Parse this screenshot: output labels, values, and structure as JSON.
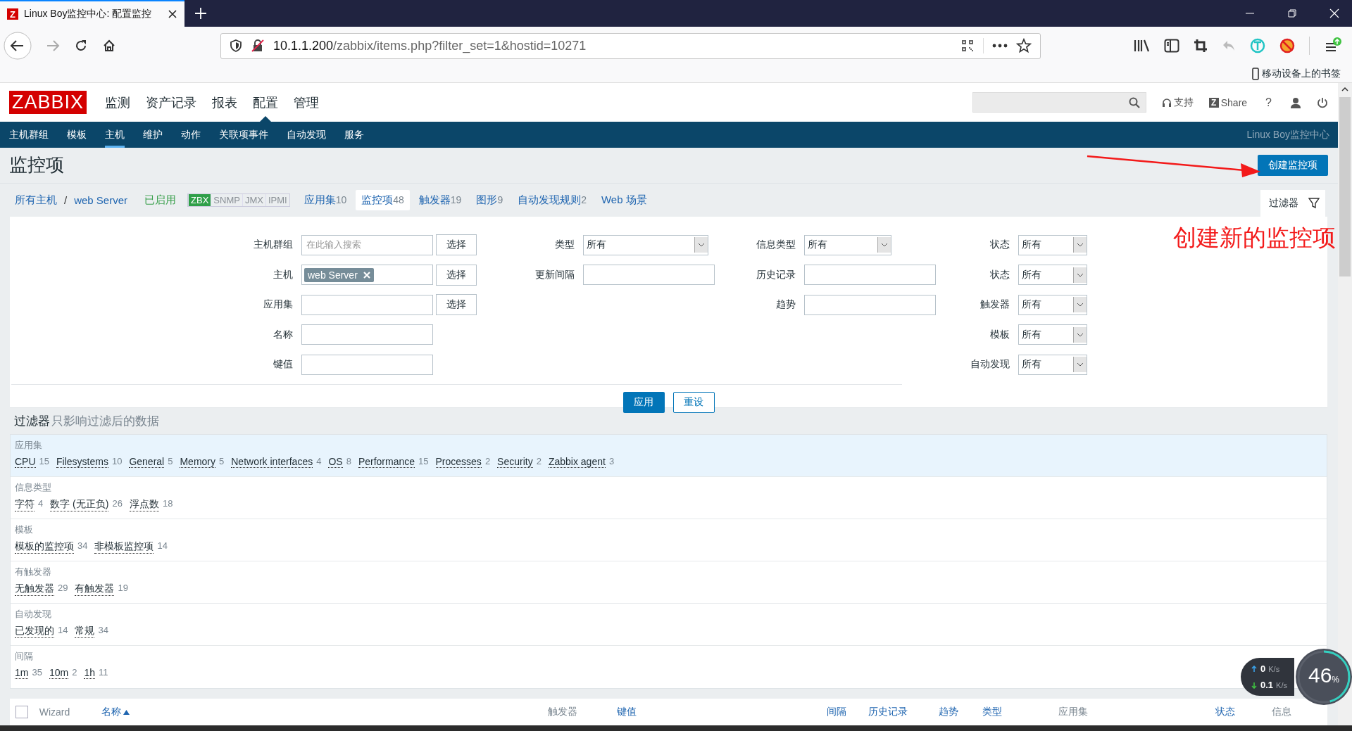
{
  "browser": {
    "tab": {
      "favicon": "Z",
      "title": "Linux Boy监控中心: 配置监控"
    },
    "url": {
      "host": "10.1.1.200",
      "path": "/zabbix/items.php?filter_set=1&hostid=10271"
    },
    "bookmarks": "移动设备上的书签"
  },
  "header": {
    "logo": "ZABBIX",
    "menu": [
      {
        "label": "监测",
        "selected": false
      },
      {
        "label": "资产记录",
        "selected": false
      },
      {
        "label": "报表",
        "selected": false
      },
      {
        "label": "配置",
        "selected": true
      },
      {
        "label": "管理",
        "selected": false
      }
    ],
    "support": "支持",
    "share": {
      "badge": "Z",
      "label": "Share"
    },
    "help": "?"
  },
  "nav": {
    "items": [
      {
        "label": "主机群组",
        "selected": false
      },
      {
        "label": "模板",
        "selected": false
      },
      {
        "label": "主机",
        "selected": true
      },
      {
        "label": "维护",
        "selected": false
      },
      {
        "label": "动作",
        "selected": false
      },
      {
        "label": "关联项事件",
        "selected": false
      },
      {
        "label": "自动发现",
        "selected": false
      },
      {
        "label": "服务",
        "selected": false
      }
    ],
    "server_name": "Linux Boy监控中心"
  },
  "page": {
    "title": "监控项",
    "create_button": "创建监控项"
  },
  "host_tabs": {
    "breadcrumb": [
      "所有主机",
      "web Server"
    ],
    "separator": "/",
    "status": "已启用",
    "availability": [
      {
        "label": "ZBX",
        "on": true
      },
      {
        "label": "SNMP",
        "on": false
      },
      {
        "label": "JMX",
        "on": false
      },
      {
        "label": "IPMI",
        "on": false
      }
    ],
    "tabs": [
      {
        "label": "应用集",
        "count": "10",
        "selected": false
      },
      {
        "label": "监控项",
        "count": "48",
        "selected": true
      },
      {
        "label": "触发器",
        "count": "19",
        "selected": false
      },
      {
        "label": "图形",
        "count": "9",
        "selected": false
      },
      {
        "label": "自动发现规则",
        "count": "2",
        "selected": false
      },
      {
        "label": "Web 场景",
        "selected": false
      }
    ]
  },
  "filter": {
    "tab_label": "过滤器",
    "rows": [
      [
        {
          "label": "主机群组",
          "kind": "multiselect",
          "placeholder": "在此输入搜索",
          "button": "选择"
        },
        {
          "label": "类型",
          "kind": "select",
          "value": "所有"
        },
        {
          "label": "信息类型",
          "kind": "select",
          "value": "所有"
        },
        {
          "label": "状态",
          "kind": "select",
          "value": "所有"
        }
      ],
      [
        {
          "label": "主机",
          "kind": "multiselect",
          "tags": [
            "web Server"
          ],
          "button": "选择"
        },
        {
          "label": "更新间隔",
          "kind": "text"
        },
        {
          "label": "历史记录",
          "kind": "text"
        },
        {
          "label": "状态",
          "kind": "select",
          "value": "所有"
        }
      ],
      [
        {
          "label": "应用集",
          "kind": "multiselect",
          "button": "选择"
        },
        null,
        {
          "label": "趋势",
          "kind": "text"
        },
        {
          "label": "触发器",
          "kind": "select",
          "value": "所有"
        }
      ],
      [
        {
          "label": "名称",
          "kind": "text"
        },
        null,
        null,
        {
          "label": "模板",
          "kind": "select",
          "value": "所有"
        }
      ],
      [
        {
          "label": "键值",
          "kind": "text"
        },
        null,
        null,
        {
          "label": "自动发现",
          "kind": "select",
          "value": "所有"
        }
      ]
    ],
    "apply": "应用",
    "reset": "重设"
  },
  "subfilter": {
    "title": "过滤器",
    "note": "只影响过滤后的数据",
    "groups": [
      {
        "title": "应用集",
        "highlighted": true,
        "items": [
          {
            "label": "CPU",
            "count": "15"
          },
          {
            "label": "Filesystems",
            "count": "10"
          },
          {
            "label": "General",
            "count": "5"
          },
          {
            "label": "Memory",
            "count": "5"
          },
          {
            "label": "Network interfaces",
            "count": "4"
          },
          {
            "label": "OS",
            "count": "8"
          },
          {
            "label": "Performance",
            "count": "15"
          },
          {
            "label": "Processes",
            "count": "2"
          },
          {
            "label": "Security",
            "count": "2"
          },
          {
            "label": "Zabbix agent",
            "count": "3"
          }
        ]
      },
      {
        "title": "信息类型",
        "highlighted": false,
        "items": [
          {
            "label": "字符",
            "count": "4"
          },
          {
            "label": "数字 (无正负)",
            "count": "26"
          },
          {
            "label": "浮点数",
            "count": "18"
          }
        ]
      },
      {
        "title": "模板",
        "highlighted": false,
        "items": [
          {
            "label": "模板的监控项",
            "count": "34"
          },
          {
            "label": "非模板监控项",
            "count": "14"
          }
        ]
      },
      {
        "title": "有触发器",
        "highlighted": false,
        "items": [
          {
            "label": "无触发器",
            "count": "29"
          },
          {
            "label": "有触发器",
            "count": "19"
          }
        ]
      },
      {
        "title": "自动发现",
        "highlighted": false,
        "items": [
          {
            "label": "已发现的",
            "count": "14"
          },
          {
            "label": "常规",
            "count": "34"
          }
        ]
      },
      {
        "title": "间隔",
        "highlighted": false,
        "items": [
          {
            "label": "1m",
            "count": "35"
          },
          {
            "label": "10m",
            "count": "2"
          },
          {
            "label": "1h",
            "count": "11"
          }
        ]
      }
    ]
  },
  "table": {
    "select_all": {
      "checked": false
    },
    "columns": [
      {
        "label": "Wizard",
        "sortable": false,
        "sorted": false
      },
      {
        "label": "名称",
        "sortable": true,
        "sorted": true
      },
      {
        "label": "触发器",
        "sortable": false,
        "sorted": false
      },
      {
        "label": "键值",
        "sortable": true,
        "sorted": false
      },
      {
        "label": "间隔",
        "sortable": true,
        "sorted": false
      },
      {
        "label": "历史记录",
        "sortable": true,
        "sorted": false
      },
      {
        "label": "趋势",
        "sortable": true,
        "sorted": false
      },
      {
        "label": "类型",
        "sortable": true,
        "sorted": false
      },
      {
        "label": "应用集",
        "sortable": false,
        "sorted": false
      },
      {
        "label": "状态",
        "sortable": true,
        "sorted": false
      },
      {
        "label": "信息",
        "sortable": false,
        "sorted": false
      }
    ]
  },
  "annotation": {
    "text": "创建新的监控项"
  },
  "net_widget": {
    "up": "0",
    "down": "0.1",
    "up_unit": "K/s",
    "down_unit": "K/s",
    "percent": "46",
    "percent_sign": "%",
    "level": 0.46
  }
}
